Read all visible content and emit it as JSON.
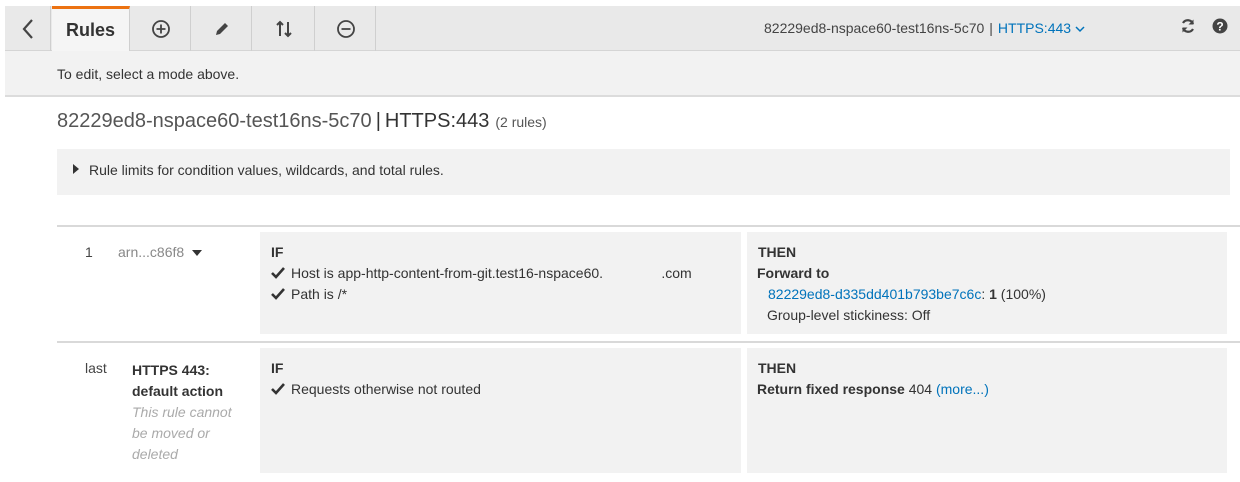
{
  "toolbar": {
    "back_icon": "chevron-left-icon",
    "rules_tab": "Rules",
    "add_icon": "plus-circle-icon",
    "edit_icon": "pencil-icon",
    "reorder_icon": "reorder-arrows-icon",
    "delete_icon": "minus-circle-icon",
    "lb_name": "82229ed8-nspace60-test16ns-5c70",
    "separator": "|",
    "listener": "HTTPS:443",
    "refresh_icon": "refresh-icon",
    "help_icon": "help-icon",
    "accent_color": "#ec7211",
    "link_color": "#0073bb"
  },
  "hint": {
    "text": "To edit, select a mode above."
  },
  "heading": {
    "lb_name": "82229ed8-nspace60-test16ns-5c70",
    "separator": "|",
    "listener": "HTTPS:443",
    "rule_count": "(2 rules)"
  },
  "limits": {
    "label": "Rule limits for condition values, wildcards, and total rules."
  },
  "rules": [
    {
      "number": "1",
      "id": "arn...c86f8",
      "if_label": "IF",
      "conditions": [
        "Host is app-http-content-from-git.test16-nspace60.               .com",
        "Path is /*"
      ],
      "then_label": "THEN",
      "action": "Forward to",
      "target_group": "82229ed8-d335dd401b793be7c6c",
      "target_colon": ":",
      "target_weight": "1",
      "target_percent": "(100%)",
      "stickiness": "Group-level stickiness: Off"
    },
    {
      "number": "last",
      "name": "HTTPS 443: default action",
      "note": "This rule cannot be moved or deleted",
      "if_label": "IF",
      "conditions": [
        "Requests otherwise not routed"
      ],
      "then_label": "THEN",
      "action": "Return fixed response",
      "status_code": "404",
      "more_link": "(more...)"
    }
  ]
}
